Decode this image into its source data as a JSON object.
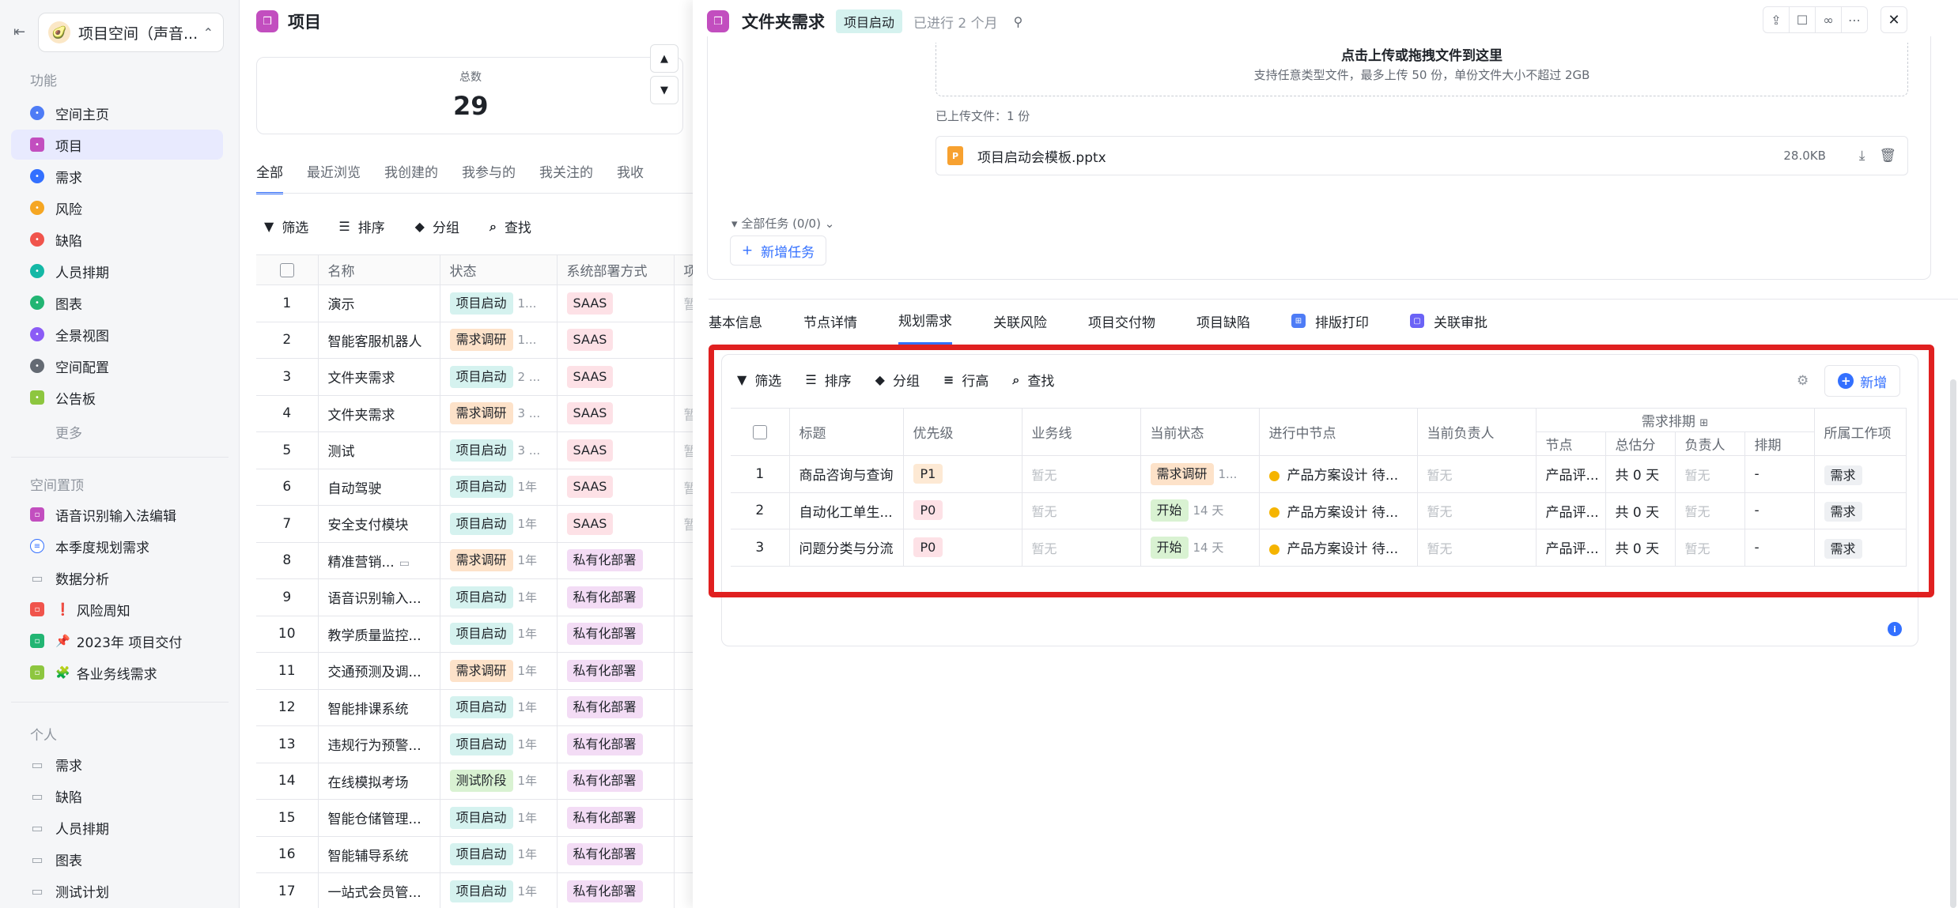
{
  "sidebar": {
    "space_name": "项目空间（声音...",
    "space_emoji": "🥑",
    "sections": {
      "features": "功能",
      "pinned": "空间置顶",
      "personal": "个人"
    },
    "feature_items": [
      {
        "label": "空间主页",
        "color": "#4e7cf6"
      },
      {
        "label": "项目",
        "color": "#c24ebf"
      },
      {
        "label": "需求",
        "color": "#3370ff"
      },
      {
        "label": "风险",
        "color": "#f5a623"
      },
      {
        "label": "缺陷",
        "color": "#f0544c"
      },
      {
        "label": "人员排期",
        "color": "#14b8a6"
      },
      {
        "label": "图表",
        "color": "#22b573"
      },
      {
        "label": "全景视图",
        "color": "#8b5cf6"
      },
      {
        "label": "空间配置",
        "color": "#646a73"
      },
      {
        "label": "公告板",
        "color": "#8dc63f"
      }
    ],
    "more_label": "更多",
    "pinned_items": [
      {
        "label": "语音识别输入法编辑",
        "emoji": ""
      },
      {
        "label": "本季度规划需求",
        "emoji": ""
      },
      {
        "label": "数据分析",
        "emoji": ""
      },
      {
        "label": "风险周知",
        "emoji": "❗"
      },
      {
        "label": "2023年 项目交付",
        "emoji": "📌"
      },
      {
        "label": "各业务线需求",
        "emoji": "🧩"
      }
    ],
    "personal_items": [
      {
        "label": "需求"
      },
      {
        "label": "缺陷"
      },
      {
        "label": "人员排期"
      },
      {
        "label": "图表"
      },
      {
        "label": "测试计划"
      }
    ]
  },
  "list": {
    "title": "项目",
    "total_label": "总数",
    "total_value": "29",
    "tabs": [
      "全部",
      "最近浏览",
      "我创建的",
      "我参与的",
      "我关注的",
      "我收"
    ],
    "toolbar": {
      "filter": "筛选",
      "sort": "排序",
      "group": "分组",
      "find": "查找"
    },
    "columns": [
      "名称",
      "状态",
      "系统部署方式",
      "项"
    ],
    "rows": [
      {
        "no": "1",
        "name": "演示",
        "status": "项目启动",
        "status_type": "start",
        "duration": "1...",
        "deploy": "SAAS",
        "extra": "暂"
      },
      {
        "no": "2",
        "name": "智能客服机器人",
        "status": "需求调研",
        "status_type": "research",
        "duration": "1...",
        "deploy": "SAAS",
        "extra": ""
      },
      {
        "no": "3",
        "name": "文件夹需求",
        "status": "项目启动",
        "status_type": "start",
        "duration": "2 ...",
        "deploy": "SAAS",
        "extra": ""
      },
      {
        "no": "4",
        "name": "文件夹需求",
        "status": "需求调研",
        "status_type": "research",
        "duration": "3 ...",
        "deploy": "SAAS",
        "extra": "暂"
      },
      {
        "no": "5",
        "name": "测试",
        "status": "项目启动",
        "status_type": "start",
        "duration": "3 ...",
        "deploy": "SAAS",
        "extra": "暂"
      },
      {
        "no": "6",
        "name": "自动驾驶",
        "status": "项目启动",
        "status_type": "start",
        "duration": "1年",
        "deploy": "SAAS",
        "extra": "暂"
      },
      {
        "no": "7",
        "name": "安全支付模块",
        "status": "项目启动",
        "status_type": "start",
        "duration": "1年",
        "deploy": "SAAS",
        "extra": "暂"
      },
      {
        "no": "8",
        "name": "精准营销...",
        "status": "需求调研",
        "status_type": "research",
        "duration": "1年",
        "deploy": "私有化部署",
        "extra": ""
      },
      {
        "no": "9",
        "name": "语音识别输入...",
        "status": "项目启动",
        "status_type": "start",
        "duration": "1年",
        "deploy": "私有化部署",
        "extra": ""
      },
      {
        "no": "10",
        "name": "教学质量监控...",
        "status": "项目启动",
        "status_type": "start",
        "duration": "1年",
        "deploy": "私有化部署",
        "extra": ""
      },
      {
        "no": "11",
        "name": "交通预测及调...",
        "status": "需求调研",
        "status_type": "research",
        "duration": "1年",
        "deploy": "私有化部署",
        "extra": ""
      },
      {
        "no": "12",
        "name": "智能排课系统",
        "status": "项目启动",
        "status_type": "start",
        "duration": "1年",
        "deploy": "私有化部署",
        "extra": ""
      },
      {
        "no": "13",
        "name": "违规行为预警...",
        "status": "项目启动",
        "status_type": "start",
        "duration": "1年",
        "deploy": "私有化部署",
        "extra": ""
      },
      {
        "no": "14",
        "name": "在线模拟考场",
        "status": "测试阶段",
        "status_type": "test",
        "duration": "1年",
        "deploy": "私有化部署",
        "extra": ""
      },
      {
        "no": "15",
        "name": "智能仓储管理...",
        "status": "项目启动",
        "status_type": "start",
        "duration": "1年",
        "deploy": "私有化部署",
        "extra": ""
      },
      {
        "no": "16",
        "name": "智能辅导系统",
        "status": "项目启动",
        "status_type": "start",
        "duration": "1年",
        "deploy": "私有化部署",
        "extra": ""
      },
      {
        "no": "17",
        "name": "一站式会员管...",
        "status": "项目启动",
        "status_type": "start",
        "duration": "1年",
        "deploy": "私有化部署",
        "extra": ""
      }
    ]
  },
  "detail": {
    "title": "文件夹需求",
    "status": "项目启动",
    "elapsed": "已进行 2 个月",
    "upload_title": "点击上传或拖拽文件到这里",
    "upload_sub": "支持任意类型文件，最多上传 50 份，单份文件大小不超过 2GB",
    "uploaded_label": "已上传文件：1 份",
    "file": {
      "name": "项目启动会模板.pptx",
      "size": "28.0KB",
      "icon_letter": "P"
    },
    "task_toggle": "全部任务 (0/0)",
    "add_task": "新增任务",
    "tabs": [
      {
        "label": "基本信息",
        "icon": "",
        "color": ""
      },
      {
        "label": "节点详情",
        "icon": "",
        "color": ""
      },
      {
        "label": "规划需求",
        "icon": "",
        "color": ""
      },
      {
        "label": "关联风险",
        "icon": "",
        "color": ""
      },
      {
        "label": "项目交付物",
        "icon": "",
        "color": ""
      },
      {
        "label": "项目缺陷",
        "icon": "",
        "color": ""
      },
      {
        "label": "排版打印",
        "icon": "grid-icon",
        "color": "#4e7cf6"
      },
      {
        "label": "关联审批",
        "icon": "approval-icon",
        "color": "#6b63f6"
      }
    ],
    "active_tab": 2,
    "req_toolbar": {
      "filter": "筛选",
      "sort": "排序",
      "group": "分组",
      "row_height": "行高",
      "find": "查找",
      "add": "新增"
    },
    "req_columns": {
      "title": "标题",
      "priority": "优先级",
      "business": "业务线",
      "state": "当前状态",
      "node": "进行中节点",
      "owner": "当前负责人",
      "schedule_group": "需求排期",
      "sched_node": "节点",
      "sched_estimate": "总估分",
      "sched_owner": "负责人",
      "sched_plan": "排期",
      "work_item": "所属工作项"
    },
    "req_rows": [
      {
        "no": "1",
        "title": "商品咨询与查询",
        "priority": "P1",
        "business": "暂无",
        "state": "需求调研",
        "state_type": "research",
        "state_extra": "1...",
        "node": "产品方案设计 待...",
        "owner": "暂无",
        "sched_node": "产品评...",
        "sched_estimate": "共 0 天",
        "sched_owner": "暂无",
        "sched_plan": "-",
        "work_item": "需求"
      },
      {
        "no": "2",
        "title": "自动化工单生...",
        "priority": "P0",
        "business": "暂无",
        "state": "开始",
        "state_type": "start",
        "state_extra": "14 天",
        "node": "产品方案设计 待...",
        "owner": "暂无",
        "sched_node": "产品评...",
        "sched_estimate": "共 0 天",
        "sched_owner": "暂无",
        "sched_plan": "-",
        "work_item": "需求"
      },
      {
        "no": "3",
        "title": "问题分类与分流",
        "priority": "P0",
        "business": "暂无",
        "state": "开始",
        "state_type": "start",
        "state_extra": "14 天",
        "node": "产品方案设计 待...",
        "owner": "暂无",
        "sched_node": "产品评...",
        "sched_estimate": "共 0 天",
        "sched_owner": "暂无",
        "sched_plan": "-",
        "work_item": "需求"
      }
    ]
  }
}
